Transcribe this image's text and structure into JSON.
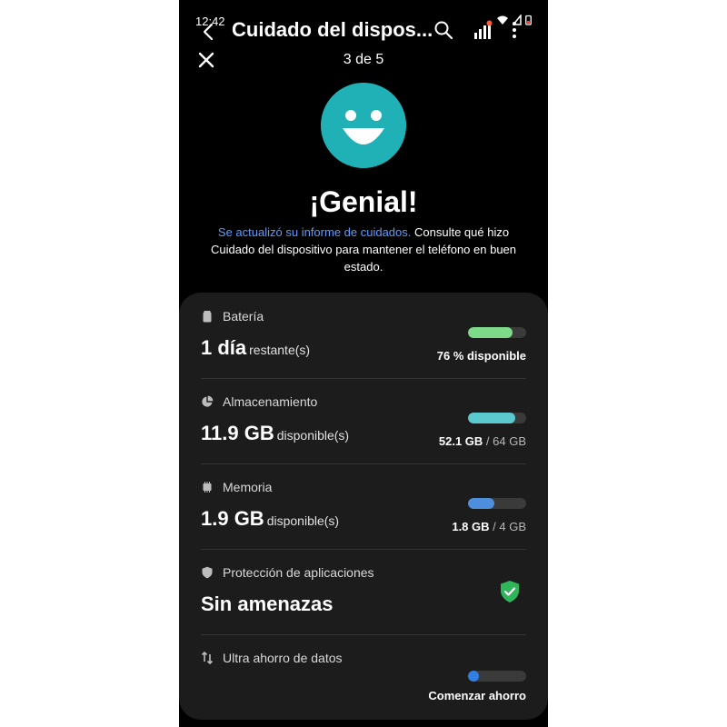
{
  "status_bar": {
    "time": "12:42"
  },
  "header": {
    "title": "Cuidado del dispos..."
  },
  "pager": {
    "text": "3 de 5"
  },
  "headline": "¡Genial!",
  "description": {
    "link": "Se actualizó su informe de cuidados.",
    "text": " Consulte qué hizo Cuidado del dispositivo para mantener el teléfono en buen estado."
  },
  "colors": {
    "accent": "#1fb1b6",
    "link": "#5f9cff",
    "battery": "#7ed989",
    "storage": "#5cc9cf",
    "memory": "#4d8fdd",
    "data_saver": "#2f7fe6",
    "shield": "#2fb65a"
  },
  "icons": {
    "back": "back-arrow-icon",
    "search": "search-icon",
    "signal": "signal-bars-icon",
    "more": "more-vertical-icon",
    "close": "close-icon",
    "battery": "battery-icon",
    "storage": "pie-chart-icon",
    "memory": "chip-icon",
    "protection": "shield-icon",
    "data_saver": "data-saver-icon",
    "check": "shield-check-icon"
  },
  "battery": {
    "label": "Batería",
    "value": "1 día",
    "unit": "restante(s)",
    "percent": 76,
    "meta": "76 % disponible"
  },
  "storage": {
    "label": "Almacenamiento",
    "value": "11.9 GB",
    "unit": "disponible(s)",
    "used": "52.1 GB",
    "total": " / 64 GB",
    "percent": 81
  },
  "memory": {
    "label": "Memoria",
    "value": "1.9 GB",
    "unit": "disponible(s)",
    "used": "1.8 GB",
    "total": " / 4 GB",
    "percent": 45
  },
  "protection": {
    "label": "Protección de aplicaciones",
    "value": "Sin amenazas"
  },
  "data_saver": {
    "label": "Ultra ahorro de datos",
    "action": "Comenzar ahorro",
    "percent": 18
  }
}
